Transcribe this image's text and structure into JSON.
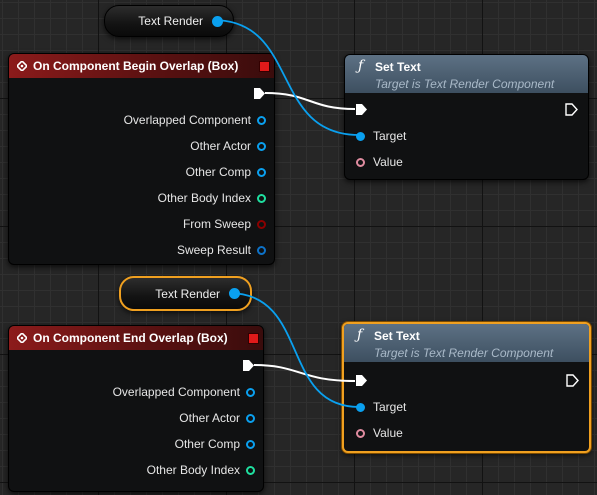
{
  "colors": {
    "object_pin": "#0aa0ef",
    "text_pin": "#e08ca0",
    "int_pin": "#1fe0a0",
    "bool_pin": "#8b0000",
    "struct_pin": "#0d72c8",
    "selected_outline": "#f0a020",
    "exec_wire": "#ffffff"
  },
  "var_nodes": [
    {
      "label": "Text Render",
      "icon": "object-pin-icon",
      "selected": false
    },
    {
      "label": "Text Render",
      "icon": "object-pin-icon",
      "selected": true
    }
  ],
  "begin_overlap": {
    "title": "On Component Begin Overlap (Box)",
    "icon": "event-diamond-icon",
    "outputs": [
      {
        "label": "Overlapped Component",
        "pin": "object"
      },
      {
        "label": "Other Actor",
        "pin": "object"
      },
      {
        "label": "Other Comp",
        "pin": "object"
      },
      {
        "label": "Other Body Index",
        "pin": "int"
      },
      {
        "label": "From Sweep",
        "pin": "bool"
      },
      {
        "label": "Sweep Result",
        "pin": "struct"
      }
    ]
  },
  "end_overlap": {
    "title": "On Component End Overlap (Box)",
    "icon": "event-diamond-icon",
    "outputs": [
      {
        "label": "Overlapped Component",
        "pin": "object"
      },
      {
        "label": "Other Actor",
        "pin": "object"
      },
      {
        "label": "Other Comp",
        "pin": "object"
      },
      {
        "label": "Other Body Index",
        "pin": "int"
      }
    ]
  },
  "set_text_1": {
    "title": "Set Text",
    "subtitle": "Target is Text Render Component",
    "icon": "function-icon",
    "inputs": [
      {
        "label": "Target",
        "pin": "object"
      },
      {
        "label": "Value",
        "pin": "text"
      }
    ]
  },
  "set_text_2": {
    "title": "Set Text",
    "subtitle": "Target is Text Render Component",
    "icon": "function-icon",
    "inputs": [
      {
        "label": "Target",
        "pin": "object"
      },
      {
        "label": "Value",
        "pin": "text"
      }
    ]
  }
}
